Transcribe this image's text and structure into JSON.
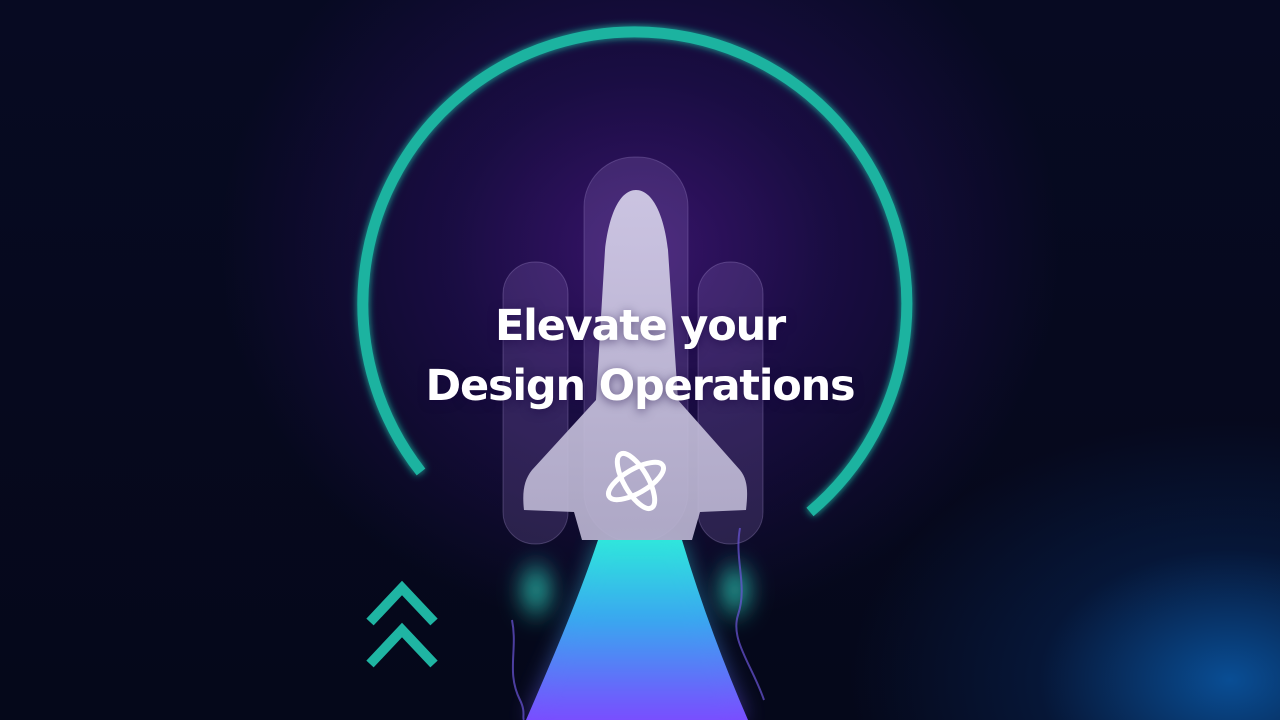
{
  "hero": {
    "title_line1": "Elevate your",
    "title_line2": "Design Operations"
  },
  "icons": {
    "logo": "four-petal-knot-logo-icon",
    "arrows": "double-chevron-up-icon",
    "ring": "teal-orbit-ring"
  },
  "colors": {
    "background": "#05081a",
    "glow_purple": "#3a146e",
    "ring_teal": "#1bb3a0",
    "chevron_teal": "#1fb5a3",
    "rocket_body": "#c9c3dd",
    "flame_cyan": "#27e0d8",
    "flame_violet": "#6a4cff",
    "text": "#ffffff"
  }
}
